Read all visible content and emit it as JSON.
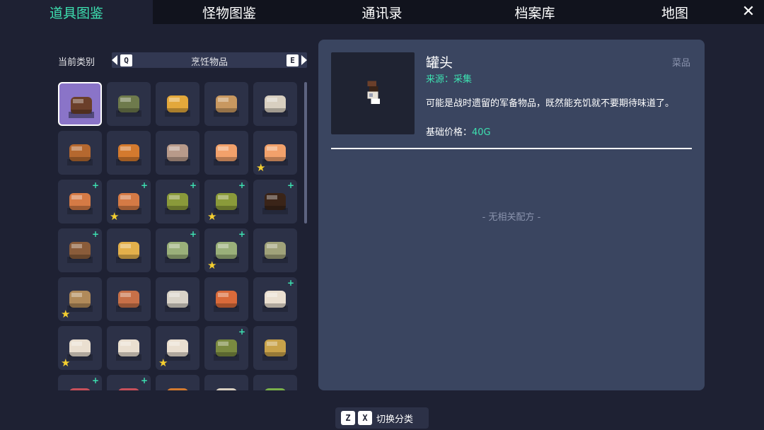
{
  "tabs": [
    {
      "label": "道具图鉴",
      "active": true
    },
    {
      "label": "怪物图鉴",
      "active": false
    },
    {
      "label": "通讯录",
      "active": false
    },
    {
      "label": "档案库",
      "active": false
    },
    {
      "label": "地图",
      "active": false
    }
  ],
  "close_label": "✕",
  "category": {
    "label": "当前类别",
    "prev_key": "Q",
    "next_key": "E",
    "current": "烹饪物品"
  },
  "detail": {
    "name": "罐头",
    "type": "菜品",
    "source": "来源：采集",
    "description": "可能是战时遗留的军备物品，既然能充饥就不要期待味道了。",
    "price_label": "基础价格：",
    "price_value": "40G",
    "no_recipe": "- 无相关配方 -"
  },
  "bottom_hint": {
    "key1": "Z",
    "key2": "X",
    "label": "切换分类"
  },
  "items": [
    {
      "name": "canned-food",
      "color": "#6b3f2a",
      "selected": true,
      "star": false,
      "plus": false
    },
    {
      "name": "bread-loaf",
      "color": "#6e7a4c",
      "selected": false,
      "star": false,
      "plus": false
    },
    {
      "name": "cake-slice",
      "color": "#e3a83b",
      "selected": false,
      "star": false,
      "plus": false
    },
    {
      "name": "baguette",
      "color": "#c89860",
      "selected": false,
      "star": false,
      "plus": false
    },
    {
      "name": "cheesecake",
      "color": "#d8cfc0",
      "selected": false,
      "star": false,
      "plus": false
    },
    {
      "name": "burger",
      "color": "#b5682f",
      "selected": false,
      "star": false,
      "plus": false
    },
    {
      "name": "pie-slice",
      "color": "#d47a2e",
      "selected": false,
      "star": false,
      "plus": false
    },
    {
      "name": "cocoa-cup",
      "color": "#b89a8a",
      "selected": false,
      "star": false,
      "plus": false
    },
    {
      "name": "swiss-roll",
      "color": "#f2a16b",
      "selected": false,
      "star": false,
      "plus": false
    },
    {
      "name": "swiss-roll-star",
      "color": "#f2a16b",
      "selected": false,
      "star": true,
      "plus": false
    },
    {
      "name": "grilled-fish",
      "color": "#d57a45",
      "selected": false,
      "star": false,
      "plus": true
    },
    {
      "name": "grilled-fish-star",
      "color": "#d57a45",
      "selected": false,
      "star": true,
      "plus": true
    },
    {
      "name": "skewer",
      "color": "#8a9a3a",
      "selected": false,
      "star": false,
      "plus": true
    },
    {
      "name": "skewer-star",
      "color": "#8a9a3a",
      "selected": false,
      "star": true,
      "plus": true
    },
    {
      "name": "dark-meat",
      "color": "#3a2418",
      "selected": false,
      "star": false,
      "plus": true
    },
    {
      "name": "grilled-skewer-plate",
      "color": "#8a5c3a",
      "selected": false,
      "star": false,
      "plus": true
    },
    {
      "name": "fries",
      "color": "#e3b04b",
      "selected": false,
      "star": false,
      "plus": false
    },
    {
      "name": "soup-pot",
      "color": "#9ab07a",
      "selected": false,
      "star": false,
      "plus": true
    },
    {
      "name": "soup-pot-star",
      "color": "#9ab07a",
      "selected": false,
      "star": true,
      "plus": true
    },
    {
      "name": "salad-plate",
      "color": "#a0a27a",
      "selected": false,
      "star": false,
      "plus": false
    },
    {
      "name": "dumpling-plate-star",
      "color": "#b08a5a",
      "selected": false,
      "star": true,
      "plus": false
    },
    {
      "name": "taco",
      "color": "#c77048",
      "selected": false,
      "star": false,
      "plus": false
    },
    {
      "name": "curry-rice",
      "color": "#d9d3c8",
      "selected": false,
      "star": false,
      "plus": false
    },
    {
      "name": "pasta",
      "color": "#d96a3a",
      "selected": false,
      "star": false,
      "plus": false
    },
    {
      "name": "steamed-bun",
      "color": "#eadfd0",
      "selected": false,
      "star": false,
      "plus": true
    },
    {
      "name": "steamed-bun-star",
      "color": "#eadfd0",
      "selected": false,
      "star": true,
      "plus": false
    },
    {
      "name": "steamed-bun-2",
      "color": "#eadfd0",
      "selected": false,
      "star": false,
      "plus": false
    },
    {
      "name": "steamed-bun-3-star",
      "color": "#eadfd0",
      "selected": false,
      "star": true,
      "plus": false
    },
    {
      "name": "sushi-board",
      "color": "#7a8a40",
      "selected": false,
      "star": false,
      "plus": true
    },
    {
      "name": "stew-bowl",
      "color": "#c8a24a",
      "selected": false,
      "star": false,
      "plus": false
    },
    {
      "name": "meat-plate",
      "color": "#c8505a",
      "selected": false,
      "star": false,
      "plus": true
    },
    {
      "name": "meat-plate-2",
      "color": "#c8505a",
      "selected": false,
      "star": false,
      "plus": true
    },
    {
      "name": "bread-plate",
      "color": "#d47a2e",
      "selected": false,
      "star": false,
      "plus": false
    },
    {
      "name": "cup-plate",
      "color": "#d8cfc0",
      "selected": false,
      "star": false,
      "plus": false
    },
    {
      "name": "veg-plate",
      "color": "#7ab04a",
      "selected": false,
      "star": false,
      "plus": false
    }
  ]
}
